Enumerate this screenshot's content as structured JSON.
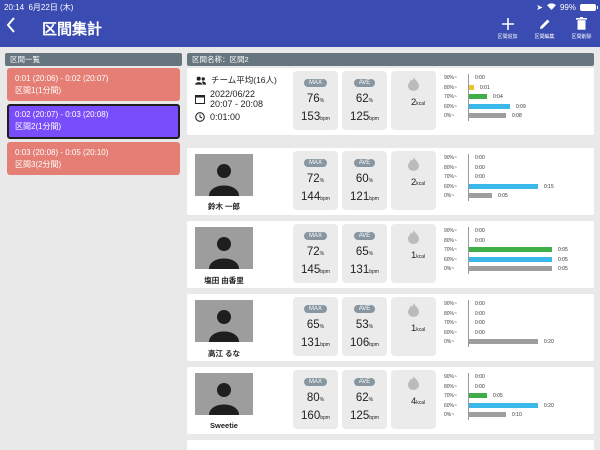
{
  "status": {
    "time": "20:14",
    "date": "6月22日 (木)",
    "battery": "99%"
  },
  "appbar": {
    "back_icon": "chevron-left-icon",
    "title": "区間集計",
    "actions": [
      {
        "label": "区間追加",
        "icon": "plus-icon"
      },
      {
        "label": "区間編集",
        "icon": "pencil-icon"
      },
      {
        "label": "区間削除",
        "icon": "trash-icon"
      }
    ]
  },
  "left": {
    "header": "区間一覧",
    "segments": [
      {
        "line1": "0:01 (20:06) - 0:02 (20:07)",
        "line2": "区間1(1分間)",
        "active": false
      },
      {
        "line1": "0:02 (20:07) - 0:03 (20:08)",
        "line2": "区間2(1分間)",
        "active": true
      },
      {
        "line1": "0:03 (20:08) - 0:05 (20:10)",
        "line2": "区間3(2分間)",
        "active": false
      }
    ]
  },
  "right": {
    "header": "区間名称：区間2",
    "max_label": "MAX",
    "ave_label": "AVE",
    "summary": {
      "team": "チーム平均(16人)",
      "date": "2022/06/22",
      "range": "20:07 - 20:08",
      "duration": "0:01:00",
      "max_pct": "76",
      "max_bpm": "153",
      "ave_pct": "62",
      "ave_bpm": "125",
      "kcal": "2"
    },
    "units": {
      "pct": "%",
      "bpm": "bpm",
      "kcal": "kcal"
    },
    "zone_labels": [
      "90%~",
      "80%~",
      "70%~",
      "60%~",
      "0%~"
    ],
    "zone_colors": [
      "#e53935",
      "#f2c12e",
      "#3fae49",
      "#3bb8ea",
      "#9e9e9e"
    ],
    "summary_zones": [
      {
        "fraction": 0,
        "text": "0:00"
      },
      {
        "fraction": 0.05,
        "text": "0:01"
      },
      {
        "fraction": 0.2,
        "text": "0:04"
      },
      {
        "fraction": 0.45,
        "text": "0:09"
      },
      {
        "fraction": 0.4,
        "text": "0:08"
      }
    ],
    "people": [
      {
        "name": "鈴木 一郎",
        "max_pct": "72",
        "max_bpm": "144",
        "ave_pct": "60",
        "ave_bpm": "121",
        "kcal": "2",
        "zones": [
          {
            "fraction": 0,
            "text": "0:00"
          },
          {
            "fraction": 0,
            "text": "0:00"
          },
          {
            "fraction": 0,
            "text": "0:00"
          },
          {
            "fraction": 0.75,
            "text": "0:15"
          },
          {
            "fraction": 0.25,
            "text": "0:05"
          }
        ]
      },
      {
        "name": "塩田 由香里",
        "max_pct": "72",
        "max_bpm": "145",
        "ave_pct": "65",
        "ave_bpm": "131",
        "kcal": "1",
        "zones": [
          {
            "fraction": 0,
            "text": "0:00"
          },
          {
            "fraction": 0,
            "text": "0:00"
          },
          {
            "fraction": 0.9,
            "text": "0:05"
          },
          {
            "fraction": 0.9,
            "text": "0:05"
          },
          {
            "fraction": 0.9,
            "text": "0:05"
          }
        ]
      },
      {
        "name": "高江 るな",
        "max_pct": "65",
        "max_bpm": "131",
        "ave_pct": "53",
        "ave_bpm": "106",
        "kcal": "1",
        "zones": [
          {
            "fraction": 0,
            "text": "0:00"
          },
          {
            "fraction": 0,
            "text": "0:00"
          },
          {
            "fraction": 0,
            "text": "0:00"
          },
          {
            "fraction": 0,
            "text": "0:00"
          },
          {
            "fraction": 0.75,
            "text": "0:20"
          }
        ]
      },
      {
        "name": "Sweetie",
        "max_pct": "80",
        "max_bpm": "160",
        "ave_pct": "62",
        "ave_bpm": "125",
        "kcal": "4",
        "zones": [
          {
            "fraction": 0,
            "text": "0:00"
          },
          {
            "fraction": 0,
            "text": "0:00"
          },
          {
            "fraction": 0.2,
            "text": "0:05"
          },
          {
            "fraction": 0.75,
            "text": "0:20"
          },
          {
            "fraction": 0.4,
            "text": "0:10"
          }
        ]
      }
    ]
  }
}
